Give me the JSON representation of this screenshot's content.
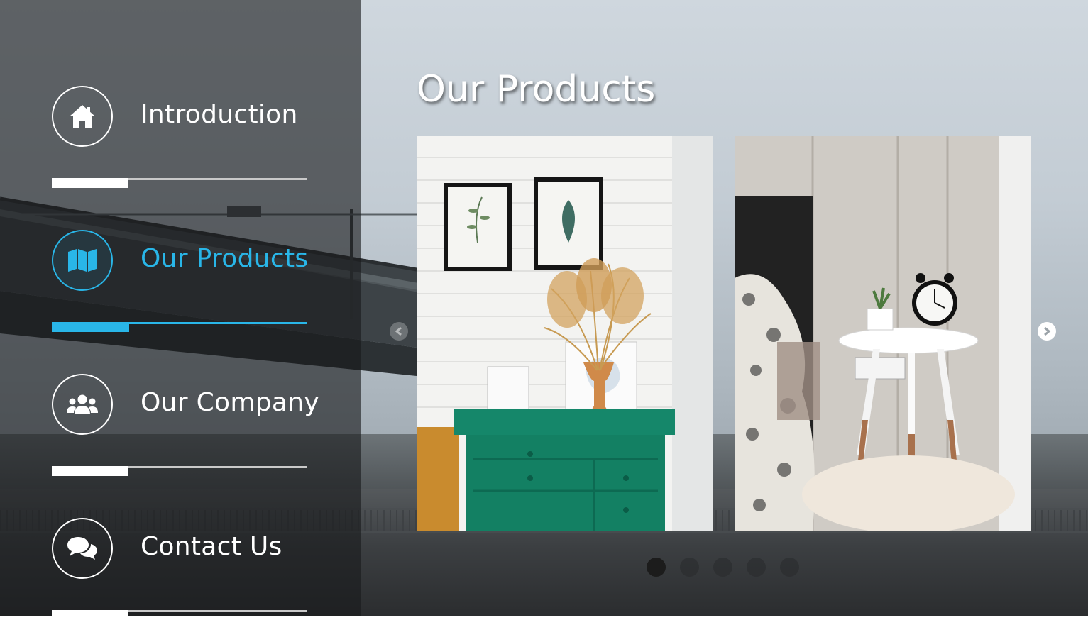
{
  "nav": {
    "items": [
      {
        "label": "Introduction",
        "icon": "home-icon",
        "active": false,
        "progress": 0.3
      },
      {
        "label": "Our Products",
        "icon": "map-icon",
        "active": true,
        "progress": 0.3
      },
      {
        "label": "Our Company",
        "icon": "users-icon",
        "active": false,
        "progress": 0.3
      },
      {
        "label": "Contact Us",
        "icon": "chat-icon",
        "active": false,
        "progress": 0.3
      }
    ]
  },
  "main": {
    "title": "Our Products",
    "carousel": {
      "slides": [
        {
          "name": "green-dresser-product"
        },
        {
          "name": "bedside-table-product"
        }
      ],
      "page_count": 5,
      "active_page": 1
    }
  },
  "colors": {
    "accent": "#29b6e8",
    "text": "#ffffff"
  }
}
